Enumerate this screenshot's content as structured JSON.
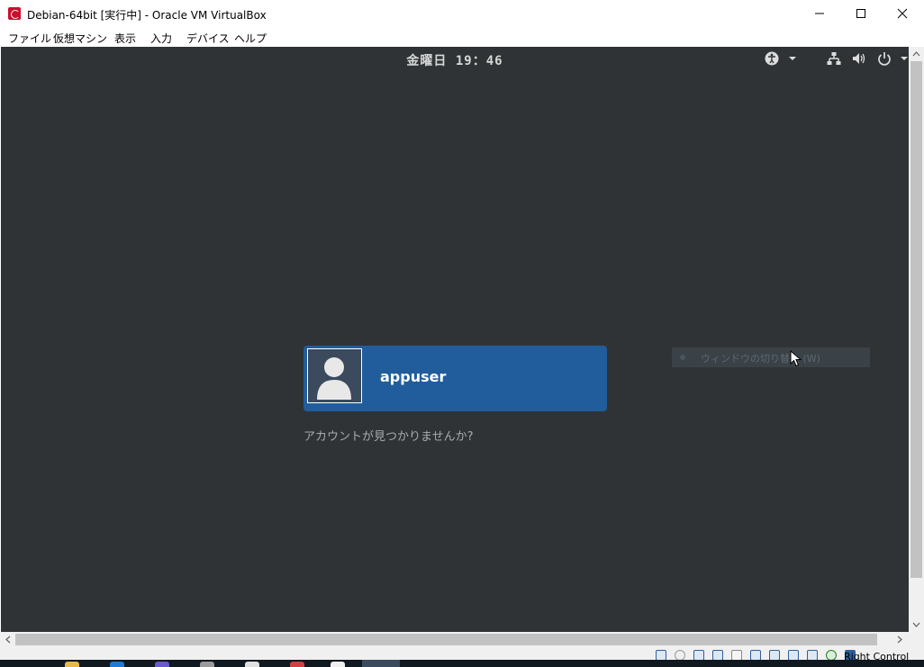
{
  "window": {
    "title": "Debian-64bit [実行中] - Oracle VM VirtualBox"
  },
  "menu": [
    {
      "label": "ファイル"
    },
    {
      "label": "仮想マシン"
    },
    {
      "label": "表示"
    },
    {
      "label": "入力"
    },
    {
      "label": "デバイス"
    },
    {
      "label": "ヘルプ"
    }
  ],
  "vm_screen": {
    "clock": "金曜日 19：46",
    "user_name": "appuser",
    "not_listed": "アカウントが見つかりませんか?",
    "tooltip": "ウィンドウの切り替え (W)"
  },
  "statusbar": {
    "host_key": "Right Control"
  },
  "icons": {
    "accessibility": "accessibility-icon",
    "network": "network-icon",
    "volume": "volume-icon",
    "power": "power-icon"
  },
  "colors": {
    "vm_background": "#2f3335",
    "user_card": "#215d9c",
    "clock_text": "#d8d8d8"
  }
}
